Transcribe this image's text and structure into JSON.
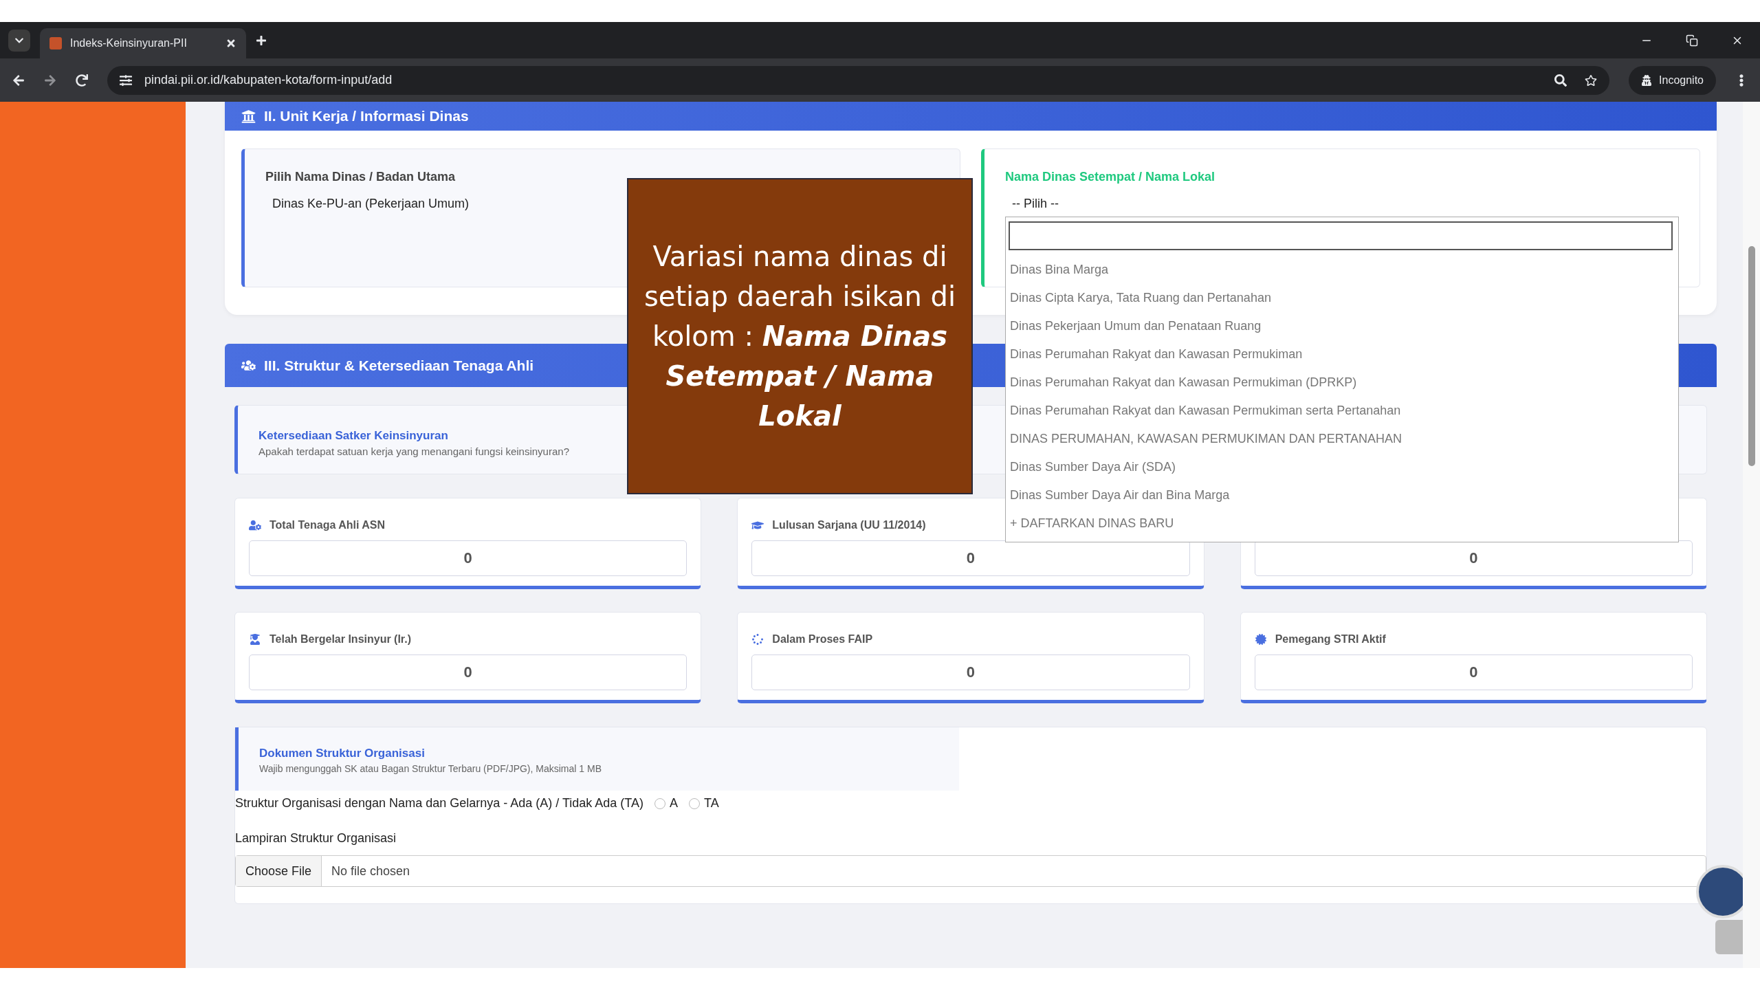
{
  "browser": {
    "tab_title": "Indeks-Keinsinyuran-PII",
    "url": "pindai.pii.or.id/kabupaten-kota/form-input/add",
    "incognito_label": "Incognito"
  },
  "section_2": {
    "title": "II. Unit Kerja / Informasi Dinas",
    "main_field": {
      "label": "Pilih Nama Dinas / Badan Utama",
      "value": "Dinas Ke-PU-an (Pekerjaan Umum)"
    },
    "local_field": {
      "label": "Nama Dinas Setempat / Nama Lokal",
      "value": "-- Pilih --",
      "expanded": true,
      "options": [
        {
          "label": "Dinas Bina Marga"
        },
        {
          "label": "Dinas Cipta Karya, Tata Ruang dan Pertanahan"
        },
        {
          "label": "Dinas Pekerjaan Umum dan Penataan Ruang"
        },
        {
          "label": "Dinas Perumahan Rakyat dan Kawasan Permukiman"
        },
        {
          "label": "Dinas Perumahan Rakyat dan Kawasan Permukiman (DPRKP)"
        },
        {
          "label": "Dinas Perumahan Rakyat dan Kawasan Permukiman serta Pertanahan"
        },
        {
          "label": "DINAS PERUMAHAN, KAWASAN PERMUKIMAN DAN PERTANAHAN"
        },
        {
          "label": "Dinas Sumber Daya Air (SDA)"
        },
        {
          "label": "Dinas Sumber Daya Air dan Bina Marga"
        },
        {
          "label": "+ DAFTARKAN DINAS BARU"
        }
      ]
    }
  },
  "note": "Variasi nama dinas di setiap daerah isikan di kolom : **Nama Dinas Setempat / Nama Lokal**",
  "section_3": {
    "title": "III. Struktur & Ketersediaan Tenaga Ahli",
    "satker": {
      "title": "Ketersediaan Satker Keinsinyuran",
      "subtitle": "Apakah terdapat satuan kerja yang menangani fungsi keinsinyuran?"
    },
    "stats": [
      {
        "kind": "user-gear",
        "label": "Total Tenaga Ahli ASN",
        "value": "0"
      },
      {
        "kind": "cap",
        "label": "Lulusan Sarjana (UU 11/2014)",
        "value": "0"
      },
      {
        "kind": "blank",
        "value": "0"
      },
      {
        "kind": "graduate",
        "label": "Telah Bergelar Insinyur (Ir.)",
        "value": "0"
      },
      {
        "kind": "spinner",
        "label": "Dalam Proses FAIP",
        "value": "0"
      },
      {
        "kind": "seal",
        "label": "Pemegang STRI Aktif",
        "value": "0"
      }
    ],
    "document": {
      "title": "Dokumen Struktur Organisasi",
      "subtitle": "Wajib mengunggah SK atau Bagan Struktur Terbaru (PDF/JPG), Maksimal 1 MB"
    },
    "radio_question": {
      "label": "Struktur Organisasi dengan Nama dan Gelarnya - Ada (A) / Tidak Ada (TA)",
      "options": [
        {
          "label": "A",
          "selected": false
        },
        {
          "label": "TA",
          "selected": false
        }
      ]
    },
    "attachment": {
      "label": "Lampiran Struktur Organisasi",
      "button": "Choose File",
      "status": "No file chosen"
    }
  }
}
